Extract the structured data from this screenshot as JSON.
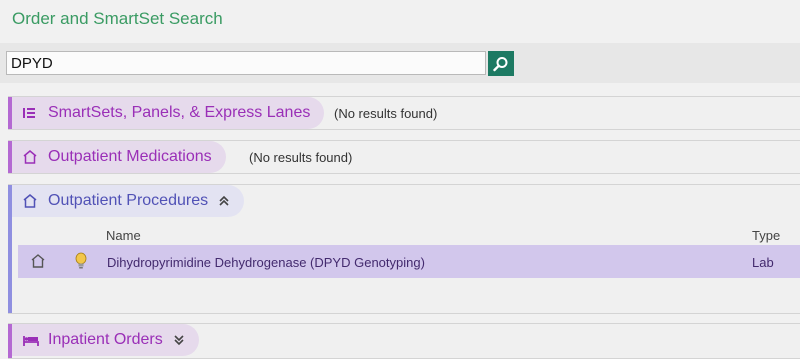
{
  "header": {
    "title": "Order and SmartSet Search"
  },
  "search": {
    "value": "DPYD",
    "button_icon": "search-icon"
  },
  "colors": {
    "title_green": "#3a9b63",
    "search_button": "#1d7a63",
    "purple_accent": "#b469d2",
    "purple_text": "#9a2fb7",
    "blue_accent": "#8f8fe0",
    "blue_text": "#5152b6",
    "row_highlight": "#d2c7ec"
  },
  "sections": [
    {
      "label": "SmartSets, Panels, & Express Lanes",
      "icon": "smartset-list-icon",
      "status": "(No results found)"
    },
    {
      "label": "Outpatient Medications",
      "icon": "home-icon",
      "status": "(No results found)"
    },
    {
      "label": "Outpatient Procedures",
      "icon": "home-icon",
      "toggle": "collapse",
      "columns": {
        "name": "Name",
        "type": "Type"
      },
      "rows": [
        {
          "icons": [
            "home-icon",
            "lightbulb-icon"
          ],
          "name": "Dihydropyrimidine Dehydrogenase (DPYD Genotyping)",
          "type": "Lab"
        }
      ]
    },
    {
      "label": "Inpatient Orders",
      "icon": "hospital-bed-icon",
      "toggle": "expand"
    }
  ]
}
